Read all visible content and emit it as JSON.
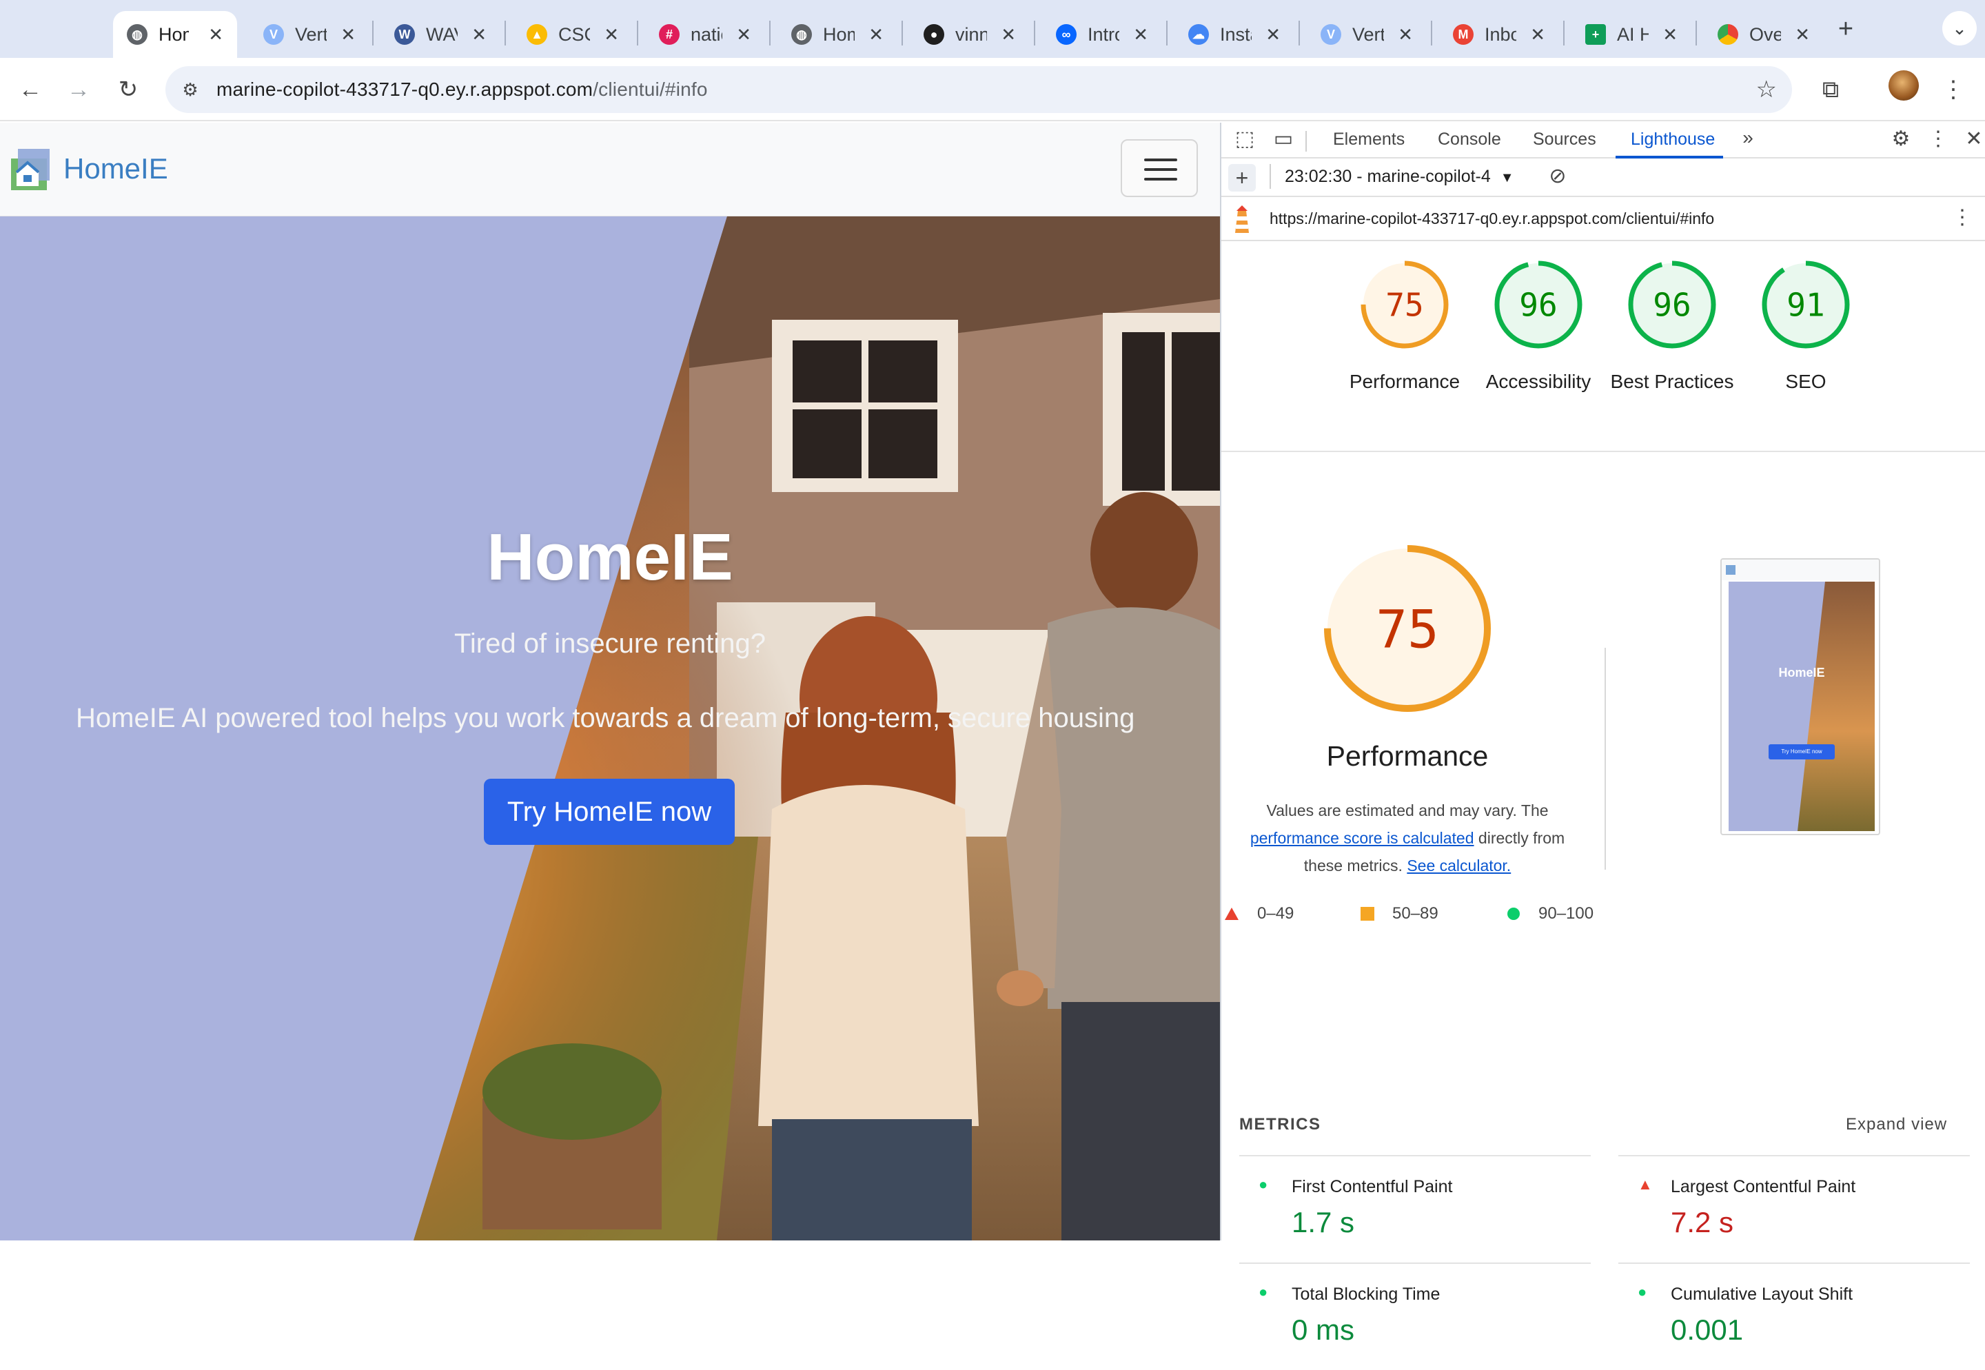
{
  "browser": {
    "tabs": [
      {
        "title": "HomeIE",
        "active": true,
        "icon": "globe-icon"
      },
      {
        "title": "Vertex AI",
        "active": false,
        "icon": "vertex-icon"
      },
      {
        "title": "WAVE",
        "active": false,
        "icon": "wave-icon"
      },
      {
        "title": "CSCI",
        "active": false,
        "icon": "drive-icon"
      },
      {
        "title": "national",
        "active": false,
        "icon": "slack-icon"
      },
      {
        "title": "HomeIE",
        "active": false,
        "icon": "globe-icon"
      },
      {
        "title": "vinny",
        "active": false,
        "icon": "github-icon"
      },
      {
        "title": "Introducing",
        "active": false,
        "icon": "meta-icon"
      },
      {
        "title": "Instances",
        "active": false,
        "icon": "cloud-icon"
      },
      {
        "title": "Vertex AI",
        "active": false,
        "icon": "vertex-icon"
      },
      {
        "title": "Inbox",
        "active": false,
        "icon": "gmail-icon"
      },
      {
        "title": "AI H",
        "active": false,
        "icon": "sheets-icon"
      },
      {
        "title": "Overview",
        "active": false,
        "icon": "chrome-icon"
      }
    ],
    "close_glyph": "✕",
    "new_tab_glyph": "+",
    "url_host": "marine-copilot-433717-q0.ey.r.appspot.com",
    "url_path": "/clientui/#info"
  },
  "page": {
    "brand_name": "HomeIE",
    "hero_title": "HomeIE",
    "hero_subtitle": "Tired of insecure renting?",
    "hero_description": "HomeIE AI powered tool helps you work towards a dream of long-term, secure housing",
    "cta_label": "Try HomeIE now"
  },
  "devtools": {
    "tabs": [
      "Elements",
      "Console",
      "Sources",
      "Lighthouse"
    ],
    "active_tab": "Lighthouse",
    "report_selector": "23:02:30 - marine-copilot-4",
    "report_url": "https://marine-copilot-433717-q0.ey.r.appspot.com/clientui/#info",
    "scores": [
      {
        "label": "Performance",
        "value": 75,
        "color": "#ef9c23"
      },
      {
        "label": "Accessibility",
        "value": 96,
        "color": "#0cb34a"
      },
      {
        "label": "Best Practices",
        "value": 96,
        "color": "#0cb34a"
      },
      {
        "label": "SEO",
        "value": 91,
        "color": "#0cb34a"
      }
    ],
    "main_score": {
      "label": "Performance",
      "value": 75,
      "color": "#ef9c23"
    },
    "note_prefix": "Values are estimated and may vary. The",
    "note_link1": "performance score is calculated",
    "note_mid1": "directly from",
    "note_mid2": "these metrics.",
    "note_link2": "See calculator.",
    "legend": [
      {
        "range": "0–49",
        "color": "#e8412f",
        "shape": "triangle"
      },
      {
        "range": "50–89",
        "color": "#f5a623",
        "shape": "square"
      },
      {
        "range": "90–100",
        "color": "#0cce6b",
        "shape": "circle"
      }
    ],
    "metrics_heading": "METRICS",
    "expand_view": "Expand view",
    "metrics": [
      {
        "name": "First Contentful Paint",
        "value": "1.7 s",
        "status": "pass"
      },
      {
        "name": "Largest Contentful Paint",
        "value": "7.2 s",
        "status": "fail"
      },
      {
        "name": "Total Blocking Time",
        "value": "0 ms",
        "status": "pass"
      },
      {
        "name": "Cumulative Layout Shift",
        "value": "0.001",
        "status": "pass"
      }
    ],
    "thumb_title": "HomeIE",
    "thumb_cta": "Try HomeIE now"
  }
}
